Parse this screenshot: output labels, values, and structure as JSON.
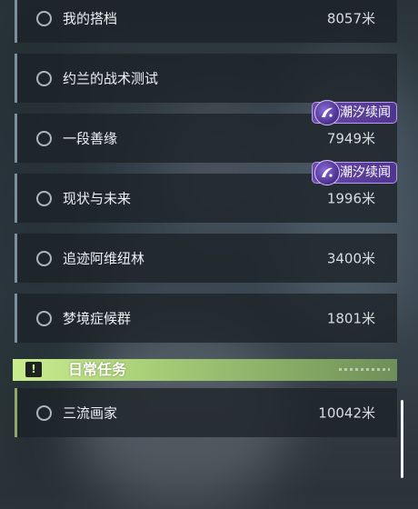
{
  "quests": [
    {
      "title": "我的搭档",
      "distance": "8057米",
      "badge": null
    },
    {
      "title": "约兰的战术测试",
      "distance": "",
      "badge": null
    },
    {
      "title": "一段善缘",
      "distance": "7949米",
      "badge": "潮汐续闻"
    },
    {
      "title": "现状与未来",
      "distance": "1996米",
      "badge": "潮汐续闻"
    },
    {
      "title": "追迹阿维纽林",
      "distance": "3400米",
      "badge": null
    },
    {
      "title": "梦境症候群",
      "distance": "1801米",
      "badge": null
    }
  ],
  "daily_section": {
    "label": "日常任务",
    "icon": "exclamation-icon",
    "quests": [
      {
        "title": "三流画家",
        "distance": "10042米"
      }
    ]
  },
  "colors": {
    "badge": "#5a3d9c",
    "daily_header": "#c9ec8e",
    "item_bg": "#1c2228"
  }
}
